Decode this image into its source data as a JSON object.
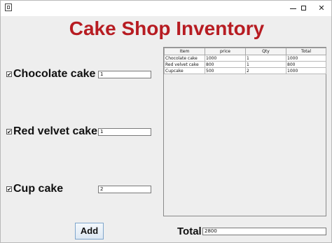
{
  "window": {
    "controls": {
      "minimize": "",
      "maximize": "",
      "close": "✕"
    }
  },
  "title": "Cake Shop Inventory",
  "items": [
    {
      "checked": true,
      "label": "Chocolate cake",
      "qty": "1"
    },
    {
      "checked": true,
      "label": "Red velvet cake",
      "qty": "1"
    },
    {
      "checked": true,
      "label": "Cup cake",
      "qty": "2"
    }
  ],
  "table": {
    "headers": [
      "Item",
      "price",
      "Qty",
      "Total"
    ],
    "rows": [
      [
        "Chocolate cake",
        "1000",
        "1",
        "1000"
      ],
      [
        "Red velvet cake",
        "800",
        "1",
        "800"
      ],
      [
        "Cupcake",
        "500",
        "2",
        "1000"
      ]
    ]
  },
  "add_button": "Add",
  "total": {
    "label": "Total",
    "value": "2800"
  }
}
